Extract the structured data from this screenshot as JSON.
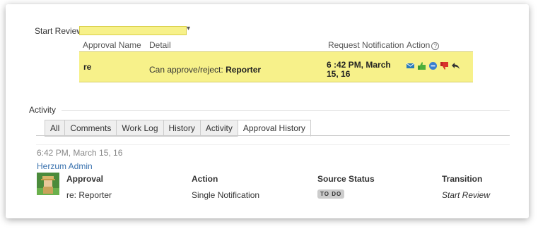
{
  "start_review": {
    "label": "Start Review",
    "chevron": "▾"
  },
  "approvals": {
    "headers": {
      "name": "Approval Name",
      "detail": "Detail",
      "request": "Request Notification",
      "action": "Action"
    },
    "help_icon": "?",
    "row": {
      "name": "re",
      "detail_prefix": "Can approve/reject:",
      "detail_value": "Reporter",
      "request_time": "6 :42 PM, March 15, 16"
    },
    "action_icons": [
      "mail-icon",
      "thumbs-up-icon",
      "minus-circle-icon",
      "thumbs-down-icon",
      "reply-icon"
    ]
  },
  "activity": {
    "title": "Activity",
    "tabs": [
      "All",
      "Comments",
      "Work Log",
      "History",
      "Activity",
      "Approval History"
    ],
    "active_tab": "Approval History",
    "entry": {
      "timestamp": "6:42 PM, March 15, 16",
      "author": "Herzum Admin",
      "headers": {
        "approval": "Approval",
        "action": "Action",
        "source_status": "Source Status",
        "transition": "Transition"
      },
      "values": {
        "approval": "re: Reporter",
        "action": "Single Notification",
        "source_status": "TO DO",
        "transition": "Start Review"
      }
    }
  },
  "colors": {
    "highlight": "#f7f18a",
    "link": "#3b73af"
  }
}
